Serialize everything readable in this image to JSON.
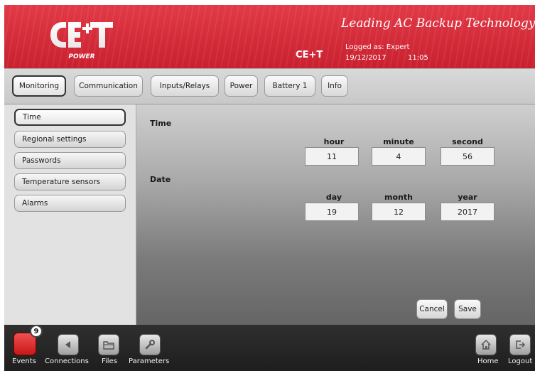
{
  "header": {
    "tagline": "Leading AC Backup Technology",
    "brand": "CE+T",
    "logo_text": "CE+T",
    "logo_sub": "POWER",
    "logged_as": "Logged as: Expert",
    "date": "19/12/2017",
    "time": "11:05"
  },
  "tabs": [
    {
      "label": "Monitoring",
      "active": true
    },
    {
      "label": "Communication",
      "active": false
    },
    {
      "label": "Inputs/Relays",
      "active": false
    },
    {
      "label": "Power",
      "active": false
    },
    {
      "label": "Battery 1",
      "active": false
    },
    {
      "label": "Info",
      "active": false
    }
  ],
  "sidebar": {
    "items": [
      {
        "label": "Time",
        "active": true
      },
      {
        "label": "Regional settings",
        "active": false
      },
      {
        "label": "Passwords",
        "active": false
      },
      {
        "label": "Temperature sensors",
        "active": false
      },
      {
        "label": "Alarms",
        "active": false
      }
    ]
  },
  "main": {
    "time_section": {
      "title": "Time",
      "hour_label": "hour",
      "hour": "11",
      "minute_label": "minute",
      "minute": "4",
      "second_label": "second",
      "second": "56"
    },
    "date_section": {
      "title": "Date",
      "day_label": "day",
      "day": "19",
      "month_label": "month",
      "month": "12",
      "year_label": "year",
      "year": "2017"
    },
    "cancel_label": "Cancel",
    "save_label": "Save"
  },
  "footer": {
    "events_label": "Events",
    "events_count": "9",
    "connections_label": "Connections",
    "files_label": "Files",
    "parameters_label": "Parameters",
    "home_label": "Home",
    "logout_label": "Logout"
  },
  "colors": {
    "header_red": "#d32a38",
    "events_red": "#d62828"
  },
  "icons": {
    "events": "alert-icon",
    "connections": "back-arrow-icon",
    "files": "folder-icon",
    "parameters": "wrench-icon",
    "home": "home-icon",
    "logout": "logout-icon"
  }
}
